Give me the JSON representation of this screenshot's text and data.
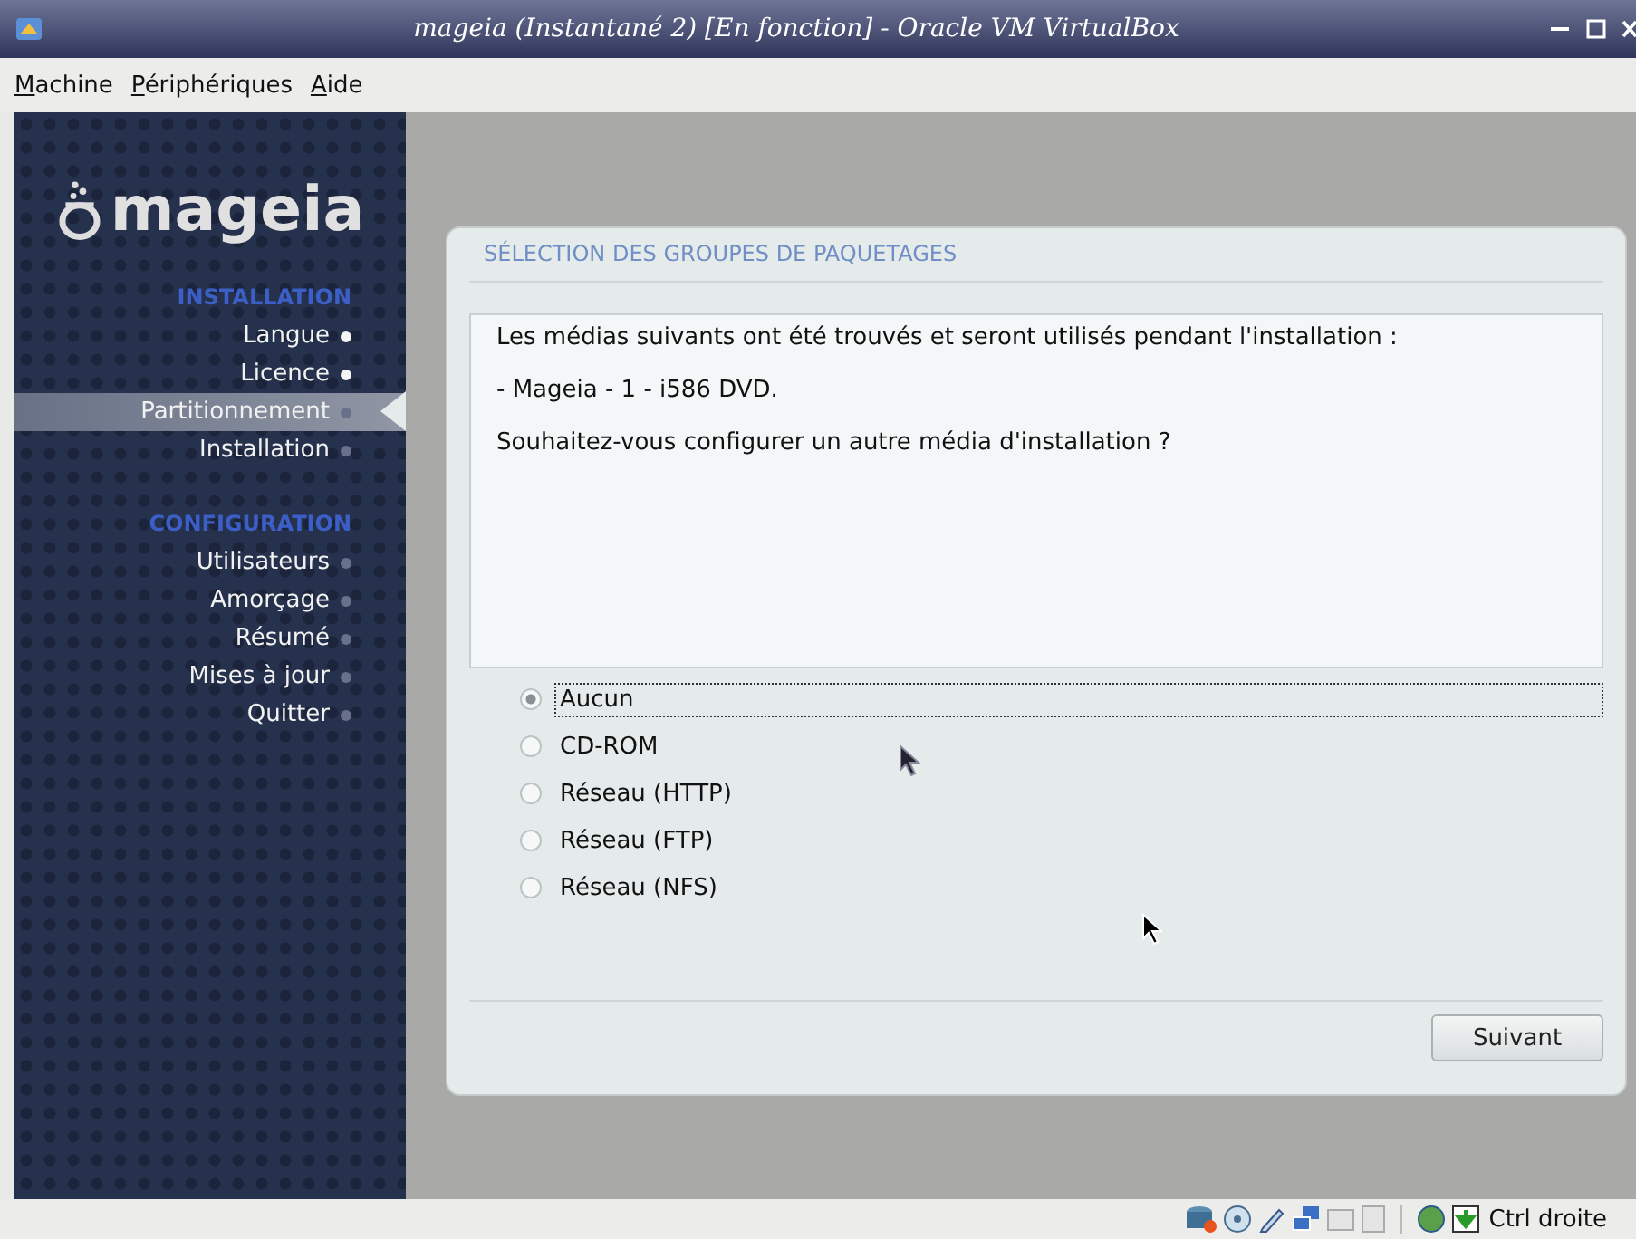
{
  "window": {
    "title": "mageia (Instantané 2) [En fonction] - Oracle VM VirtualBox"
  },
  "menu": [
    "Machine",
    "Périphériques",
    "Aide"
  ],
  "sidebar": {
    "logo_text": "mageia",
    "sections": [
      {
        "heading": "INSTALLATION",
        "items": [
          {
            "label": "Langue",
            "done": true,
            "selected": false
          },
          {
            "label": "Licence",
            "done": true,
            "selected": false
          },
          {
            "label": "Partitionnement",
            "done": false,
            "selected": true
          },
          {
            "label": "Installation",
            "done": false,
            "selected": false
          }
        ]
      },
      {
        "heading": "CONFIGURATION",
        "items": [
          {
            "label": "Utilisateurs",
            "done": false,
            "selected": false
          },
          {
            "label": "Amorçage",
            "done": false,
            "selected": false
          },
          {
            "label": "Résumé",
            "done": false,
            "selected": false
          },
          {
            "label": "Mises à jour",
            "done": false,
            "selected": false
          },
          {
            "label": "Quitter",
            "done": false,
            "selected": false
          }
        ]
      }
    ]
  },
  "panel": {
    "title": "SÉLECTION DES GROUPES DE PAQUETAGES",
    "message": [
      "Les médias suivants ont été trouvés et seront utilisés pendant l'installation :",
      "- Mageia - 1 - i586 DVD.",
      "Souhaitez-vous configurer un autre média d'installation ?"
    ],
    "options": [
      {
        "label": "Aucun",
        "selected": true,
        "focused": true
      },
      {
        "label": "CD-ROM",
        "selected": false,
        "focused": false
      },
      {
        "label": "Réseau (HTTP)",
        "selected": false,
        "focused": false
      },
      {
        "label": "Réseau (FTP)",
        "selected": false,
        "focused": false
      },
      {
        "label": "Réseau (NFS)",
        "selected": false,
        "focused": false
      }
    ],
    "button": "Suivant"
  },
  "status_bar": {
    "host_key": "Ctrl droite"
  }
}
